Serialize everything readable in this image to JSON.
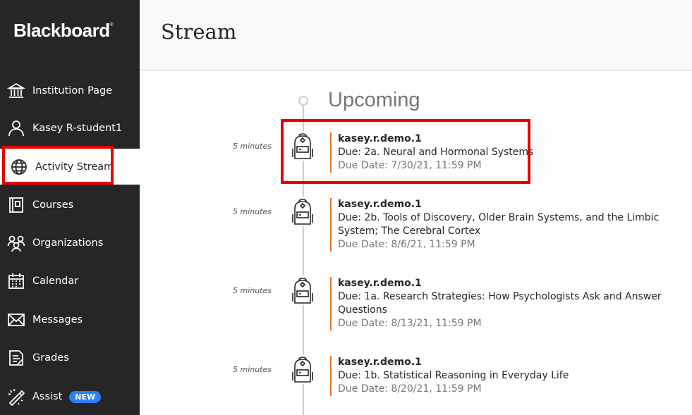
{
  "sidebar": {
    "logo": "Blackboard",
    "items": [
      {
        "label": "Institution Page",
        "icon": "institution-icon"
      },
      {
        "label": "Kasey R-student1",
        "icon": "user-icon"
      },
      {
        "label": "Activity Stream",
        "icon": "globe-icon"
      },
      {
        "label": "Courses",
        "icon": "courses-icon"
      },
      {
        "label": "Organizations",
        "icon": "organizations-icon"
      },
      {
        "label": "Calendar",
        "icon": "calendar-icon"
      },
      {
        "label": "Messages",
        "icon": "envelope-icon"
      },
      {
        "label": "Grades",
        "icon": "grades-icon"
      },
      {
        "label": "Assist",
        "icon": "assist-icon",
        "badge": "NEW"
      }
    ],
    "active": "Activity Stream"
  },
  "main": {
    "title": "Stream",
    "section": "Upcoming",
    "entries": [
      {
        "time": "5 minutes",
        "course": "kasey.r.demo.1",
        "desc": "Due: 2a. Neural and Hormonal Systems",
        "due": "Due Date: 7/30/21, 11:59 PM"
      },
      {
        "time": "5 minutes",
        "course": "kasey.r.demo.1",
        "desc": "Due: 2b. Tools of Discovery, Older Brain Systems, and the Limbic System; The Cerebral Cortex",
        "due": "Due Date: 8/6/21, 11:59 PM"
      },
      {
        "time": "5 minutes",
        "course": "kasey.r.demo.1",
        "desc": "Due: 1a. Research Strategies: How Psychologists Ask and Answer Questions",
        "due": "Due Date: 8/13/21, 11:59 PM"
      },
      {
        "time": "5 minutes",
        "course": "kasey.r.demo.1",
        "desc": "Due: 1b. Statistical Reasoning in Everyday Life",
        "due": "Due Date: 8/20/21, 11:59 PM"
      }
    ]
  },
  "colors": {
    "sidebar_bg": "#262626",
    "accent_orange": "#e87722",
    "highlight_red": "#e60000",
    "badge_blue": "#2d7ff9"
  }
}
